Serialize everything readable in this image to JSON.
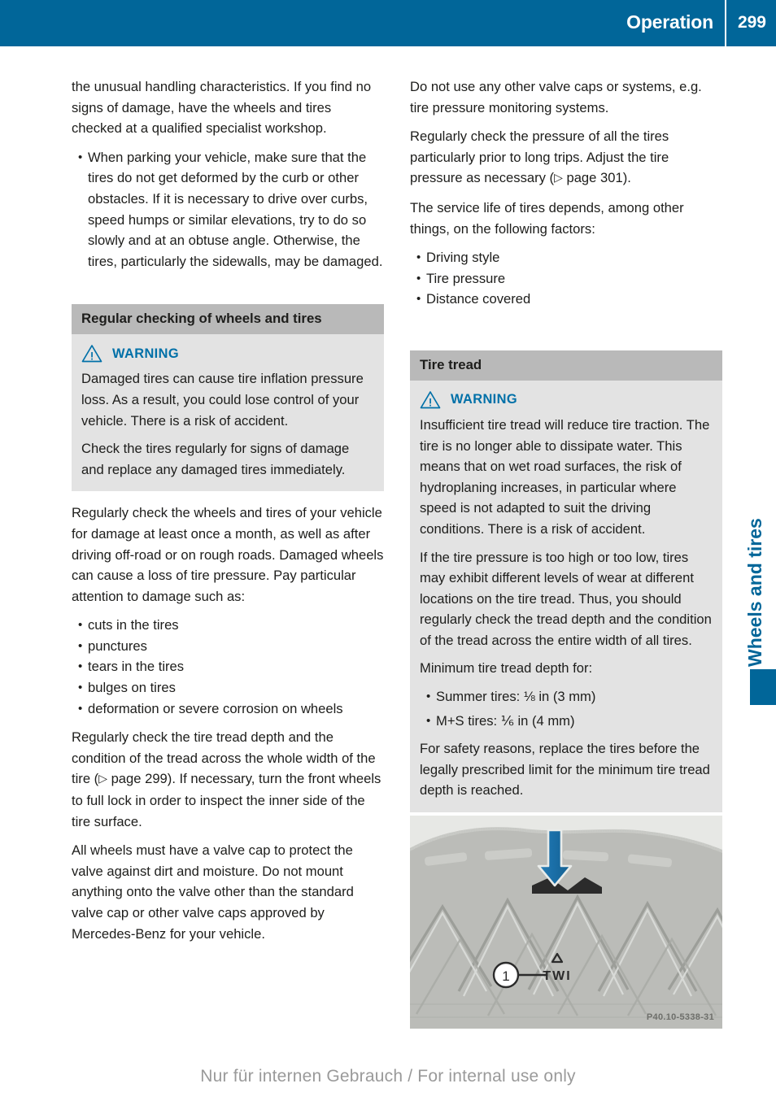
{
  "header": {
    "title": "Operation",
    "page_number": "299",
    "bar_color": "#016699"
  },
  "side_tab": {
    "label": "Wheels and tires",
    "color": "#016699"
  },
  "footer": {
    "text": "Nur für internen Gebrauch / For internal use only"
  },
  "left_column": {
    "para_continuation": "the unusual handling characteristics. If you find no signs of damage, have the wheels and tires checked at a qualified specialist workshop.",
    "bullet_parking": "When parking your vehicle, make sure that the tires do not get deformed by the curb or other obstacles. If it is necessary to drive over curbs, speed humps or similar elevations, try to do so slowly and at an obtuse angle. Otherwise, the tires, particularly the sidewalls, may be damaged.",
    "section_title": "Regular checking of wheels and tires",
    "warning": {
      "icon": "warning-triangle-icon",
      "label": "WARNING",
      "color": "#0070a8",
      "paragraphs": [
        "Damaged tires can cause tire inflation pressure loss. As a result, you could lose control of your vehicle. There is a risk of accident.",
        "Check the tires regularly for signs of damage and replace any damaged tires immediately."
      ]
    },
    "para_regular_check": "Regularly check the wheels and tires of your vehicle for damage at least once a month, as well as after driving off-road or on rough roads. Damaged wheels can cause a loss of tire pressure. Pay particular attention to damage such as:",
    "damage_bullets": [
      "cuts in the tires",
      "punctures",
      "tears in the tires",
      "bulges on tires",
      "deformation or severe corrosion on wheels"
    ],
    "para_tread_depth_a": "Regularly check the tire tread depth and the",
    "para_tread_depth_b": "condition of the tread across the whole width of the tire (",
    "para_tread_depth_ref": " page 299",
    "para_tread_depth_c": "). If necessary, turn the front wheels to full lock in order to inspect the inner side of the tire surface.",
    "para_valve_cap": "All wheels must have a valve cap to protect the valve against dirt and moisture. Do not mount anything onto the valve other than the standard valve cap or other valve caps approved by Mercedes-Benz for your vehicle."
  },
  "right_column": {
    "para_valve_caps": "Do not use any other valve caps or systems, e.g. tire pressure monitoring systems.",
    "para_pressure_a": "Regularly check the pressure of all the tires particularly prior to long trips. Adjust the tire pressure as necessary (",
    "para_pressure_ref": " page 301",
    "para_pressure_b": ").",
    "para_service_life": "The service life of tires depends, among other things, on the following factors:",
    "factors_bullets": [
      "Driving style",
      "Tire pressure",
      "Distance covered"
    ],
    "section_title": "Tire tread",
    "warning": {
      "icon": "warning-triangle-icon",
      "label": "WARNING",
      "color": "#0070a8",
      "paragraphs": [
        "Insufficient tire tread will reduce tire traction. The tire is no longer able to dissipate water. This means that on wet road surfaces, the risk of hydroplaning increases, in particular where speed is not adapted to suit the driving conditions. There is a risk of accident.",
        "If the tire pressure is too high or too low, tires may exhibit different levels of wear at different locations on the tire tread. Thus, you should regularly check the tread depth and the condition of the tread across the entire width of all tires."
      ],
      "min_depth_intro": "Minimum tire tread depth for:",
      "depth_bullets": [
        "Summer tires: ⅛ in (3 mm)",
        "M+S tires: ⅙ in (4 mm)"
      ],
      "closing": "For safety reasons, replace the tires before the legally prescribed limit for the minimum tire tread depth is reached."
    }
  },
  "figure": {
    "name": "tire-tread-wear-indicator-figure",
    "callout_number": "1",
    "twi_label": "TWI",
    "reference_code": "P40.10-5338-31",
    "arrow_color": "#1a6fa8"
  }
}
